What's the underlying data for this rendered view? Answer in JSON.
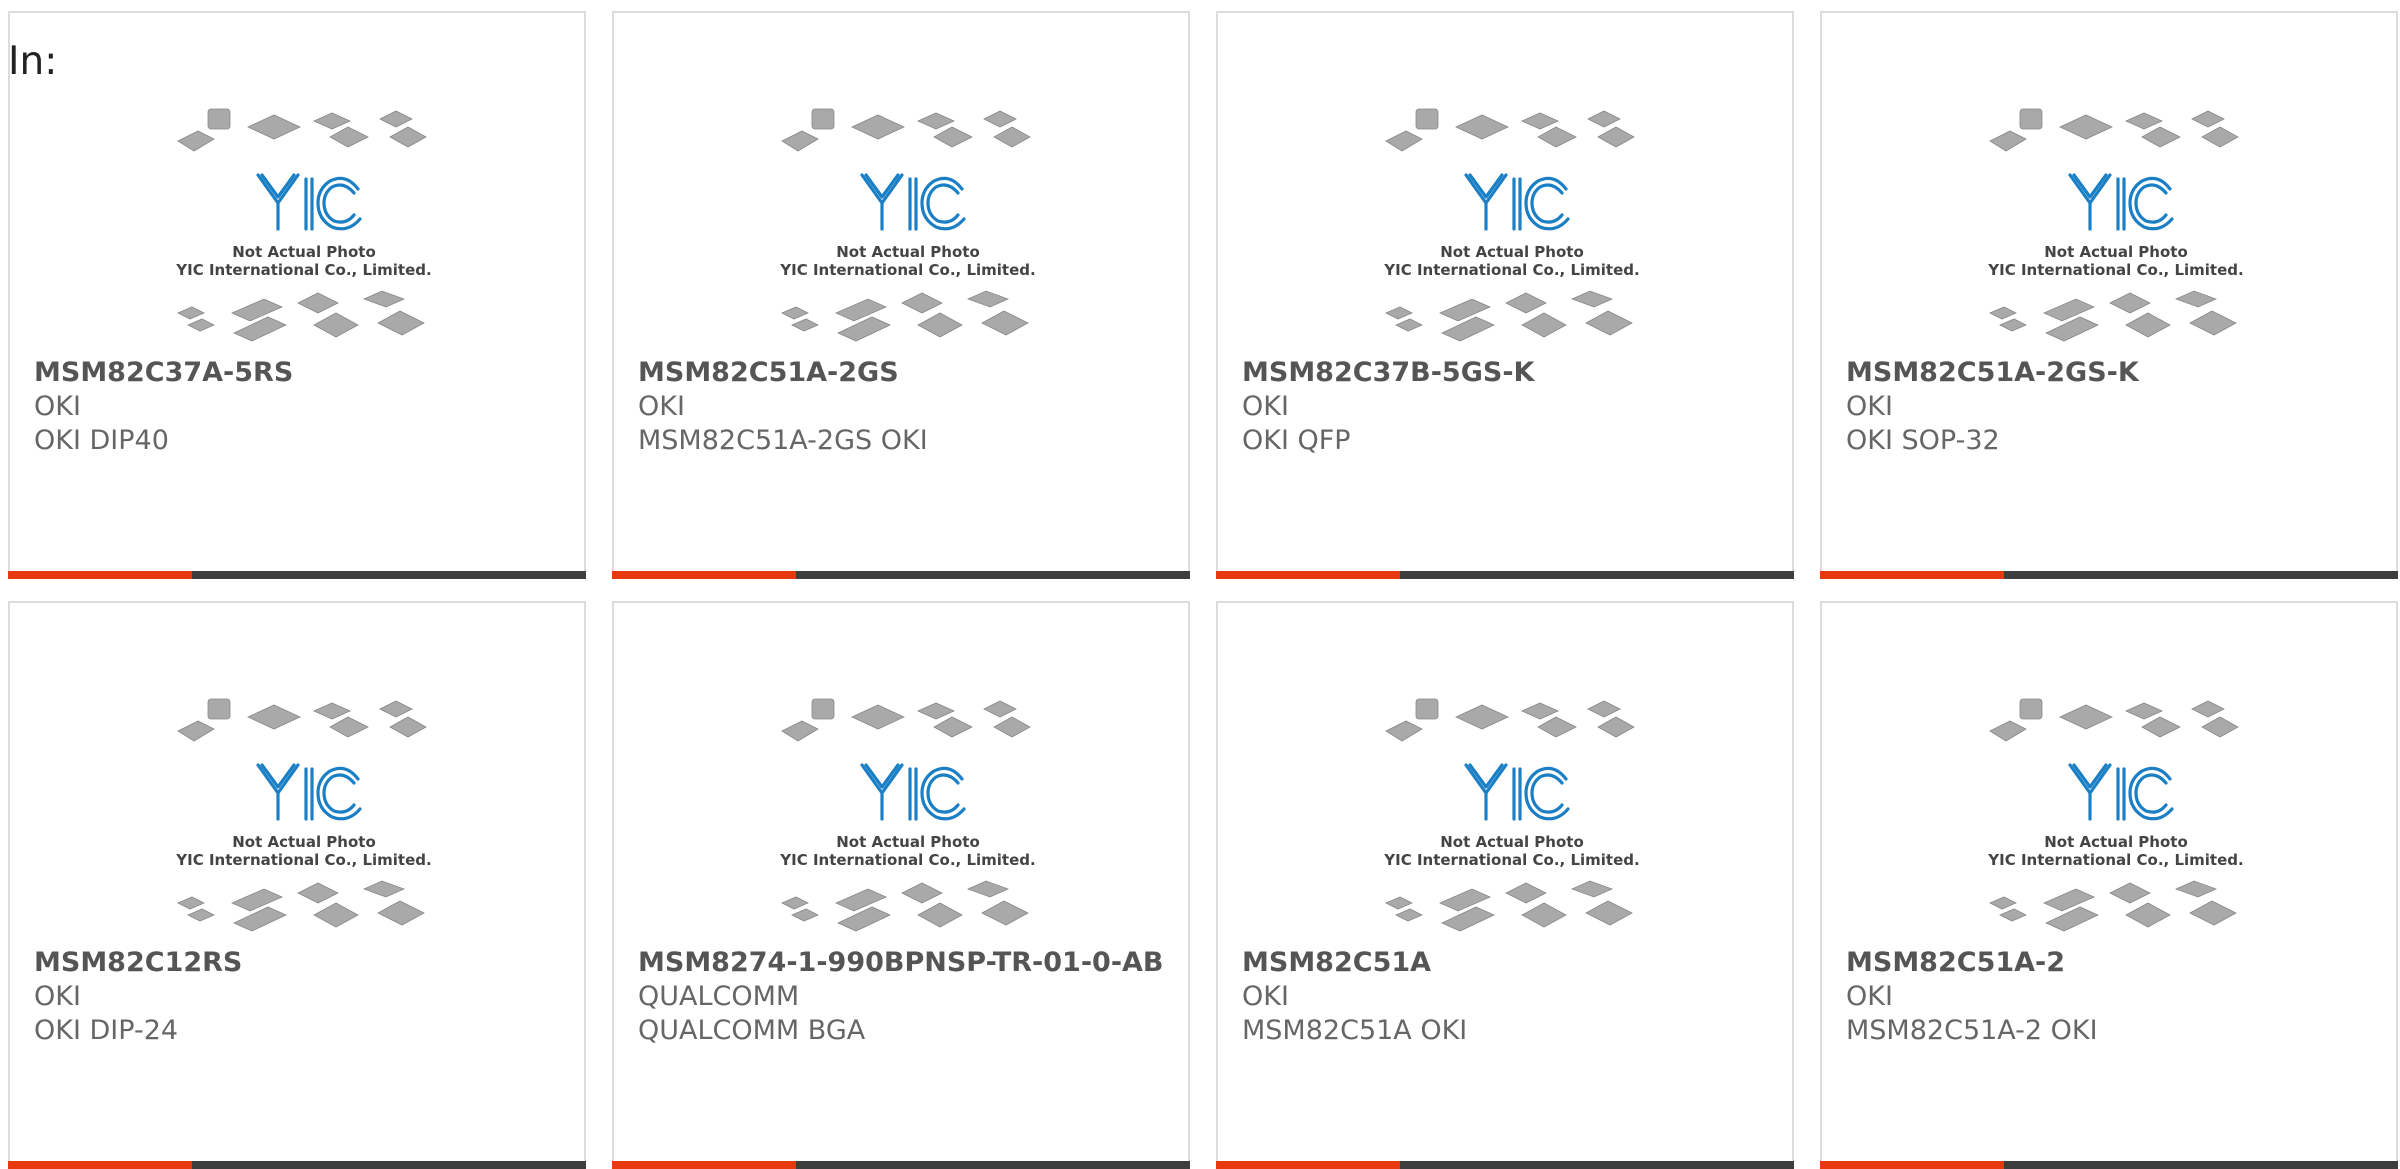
{
  "page": {
    "label": "In:"
  },
  "placeholder": {
    "caption_line1": "Not Actual Photo",
    "caption_line2": "YIC International Co., Limited.",
    "logo_text": "YIC"
  },
  "colors": {
    "accent_red": "#e8390e",
    "accent_dark": "#3d3d3d",
    "logo_blue": "#1a7fc4"
  },
  "products": [
    {
      "part": "MSM82C37A-5RS",
      "maker": "OKI",
      "desc": "OKI DIP40"
    },
    {
      "part": "MSM82C51A-2GS",
      "maker": "OKI",
      "desc": "MSM82C51A-2GS OKI"
    },
    {
      "part": "MSM82C37B-5GS-K",
      "maker": "OKI",
      "desc": "OKI QFP"
    },
    {
      "part": "MSM82C51A-2GS-K",
      "maker": "OKI",
      "desc": "OKI SOP-32"
    },
    {
      "part": "MSM82C12RS",
      "maker": "OKI",
      "desc": "OKI DIP-24"
    },
    {
      "part": "MSM8274-1-990BPNSP-TR-01-0-AB",
      "maker": "QUALCOMM",
      "desc": "QUALCOMM BGA"
    },
    {
      "part": "MSM82C51A",
      "maker": "OKI",
      "desc": "MSM82C51A OKI"
    },
    {
      "part": "MSM82C51A-2",
      "maker": "OKI",
      "desc": "MSM82C51A-2 OKI"
    }
  ]
}
